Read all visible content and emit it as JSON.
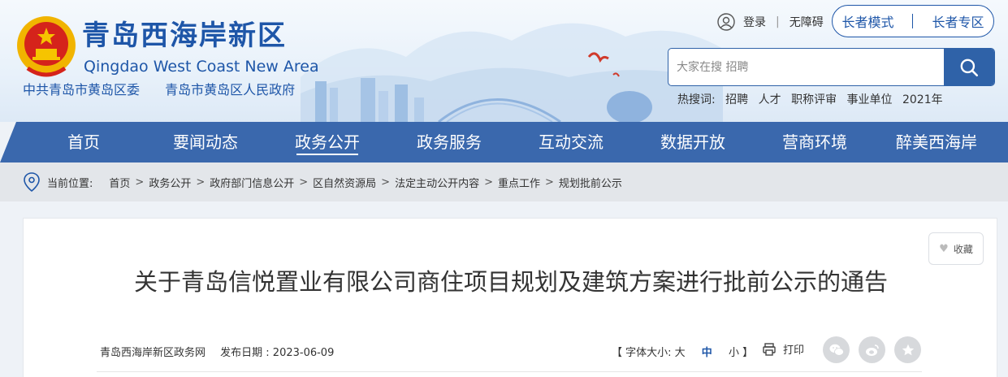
{
  "header": {
    "site_title": "青岛西海岸新区",
    "site_subtitle": "Qingdao West Coast New Area",
    "gov_links": [
      "中共青岛市黄岛区委",
      "青岛市黄岛区人民政府"
    ],
    "login": "登录",
    "accessibility": "无障碍",
    "elder_mode": "长者模式",
    "elder_zone": "长者专区",
    "search_placeholder": "大家在搜 招聘",
    "hot_label": "热搜词:",
    "hot_words": [
      "招聘",
      "人才",
      "职称评审",
      "事业单位",
      "2021年"
    ]
  },
  "nav": {
    "items": [
      "首页",
      "要闻动态",
      "政务公开",
      "政务服务",
      "互动交流",
      "数据开放",
      "营商环境",
      "醉美西海岸"
    ],
    "active_index": 2
  },
  "breadcrumb": {
    "label": "当前位置:",
    "items": [
      "首页",
      "政务公开",
      "政府部门信息公开",
      "区自然资源局",
      "法定主动公开内容",
      "重点工作",
      "规划批前公示"
    ],
    "separator": ">"
  },
  "article": {
    "favorite": "收藏",
    "title": "关于青岛信悦置业有限公司商住项目规划及建筑方案进行批前公示的通告",
    "source": "青岛西海岸新区政务网",
    "date": "发布日期 : 2023-06-09",
    "font_label": "【 字体大小: 大",
    "font_mid": "中",
    "font_small": "小 】",
    "print": "打印"
  },
  "colors": {
    "brand_blue": "#1e56a8",
    "nav_blue": "#3a68ad",
    "crumb_bg": "#e3e6ea"
  },
  "icons": [
    "national-emblem-icon",
    "user-icon",
    "search-icon",
    "location-pin-icon",
    "heart-icon",
    "printer-icon",
    "wechat-icon",
    "weibo-icon",
    "star-icon"
  ]
}
